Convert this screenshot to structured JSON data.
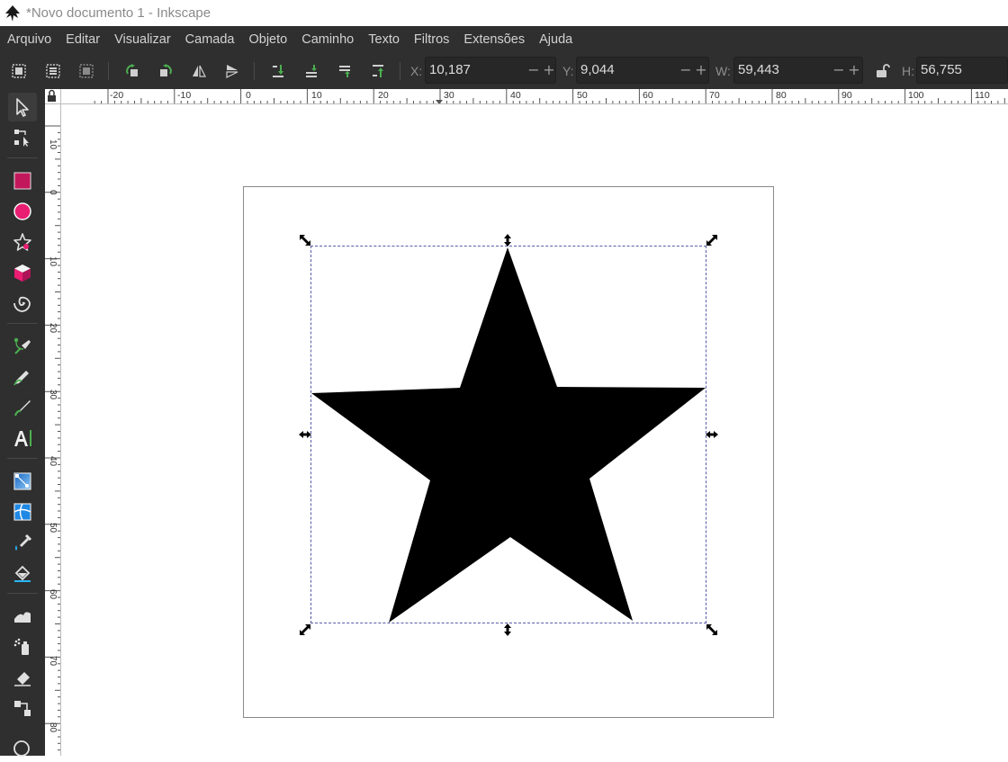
{
  "window": {
    "title": "*Novo documento 1 - Inkscape"
  },
  "menu": {
    "items": [
      "Arquivo",
      "Editar",
      "Visualizar",
      "Camada",
      "Objeto",
      "Caminho",
      "Texto",
      "Filtros",
      "Extensões",
      "Ajuda"
    ]
  },
  "toolbar": {
    "x": {
      "label": "X:",
      "value": "10,187"
    },
    "y": {
      "label": "Y:",
      "value": "9,044"
    },
    "w": {
      "label": "W:",
      "value": "59,443"
    },
    "h": {
      "label": "H:",
      "value": "56,755"
    },
    "minus": "−",
    "plus": "+"
  },
  "rulers": {
    "horizontal": [
      "-20",
      "-10",
      "0",
      "10",
      "20",
      "30",
      "40",
      "50",
      "60",
      "70",
      "80",
      "90",
      "100",
      "110"
    ],
    "vertical": [
      "10",
      "0",
      "10",
      "20",
      "30",
      "40",
      "50",
      "60",
      "70",
      "80"
    ]
  },
  "colors": {
    "chrome": "#2f2f2f",
    "accent_magenta": "#d81b6a",
    "star_fill": "#000000",
    "selection": "#5a5aa8"
  }
}
